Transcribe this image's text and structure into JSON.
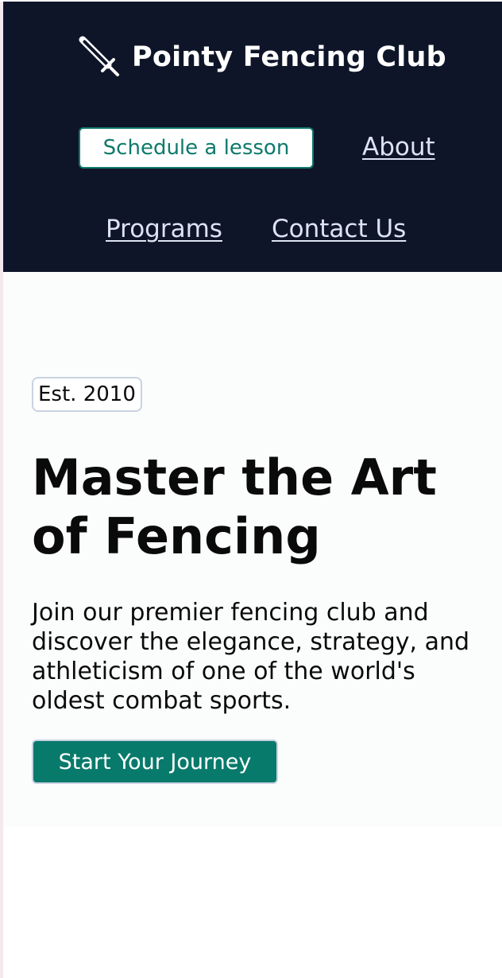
{
  "header": {
    "brand_icon": "sword-icon",
    "brand_name": "Pointy Fencing Club",
    "background_color": "#0f1529",
    "nav": {
      "schedule_label": "Schedule a lesson",
      "about_label": "About",
      "programs_label": "Programs",
      "contact_label": "Contact Us"
    }
  },
  "hero": {
    "badge": "Est. 2010",
    "title": "Master the Art of Fencing",
    "description": "Join our premier fencing club and discover the elegance, strategy, and athleticism of one of the world's oldest combat sports.",
    "cta_label": "Start Your Journey",
    "accent_color": "#087a6b"
  }
}
